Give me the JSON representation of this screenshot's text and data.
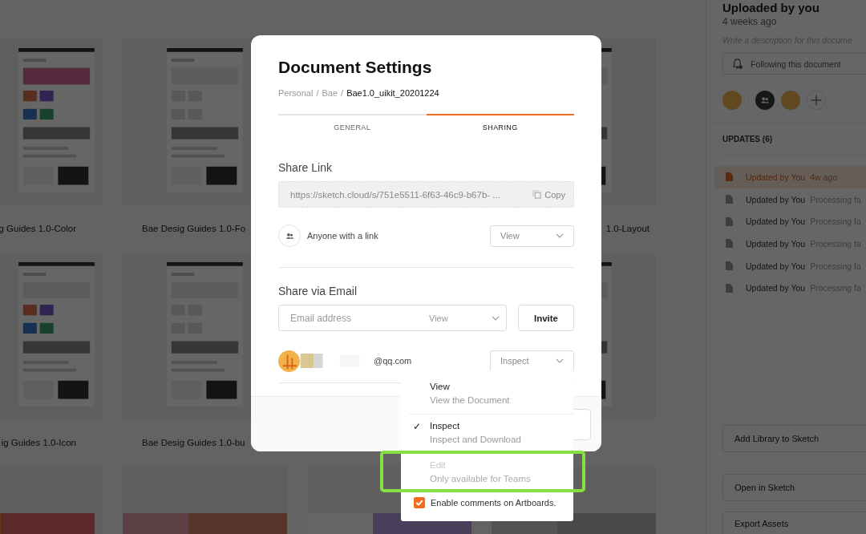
{
  "gallery": {
    "rows": [
      {
        "cards": [
          {
            "kind": "artboard",
            "label": "g Guides 1.0-Color"
          },
          {
            "kind": "artboard",
            "label": "Bae Desig Guides 1.0-Fo"
          },
          {
            "kind": "hidden"
          },
          {
            "kind": "artboard",
            "label": "1.0-Layout"
          }
        ]
      },
      {
        "cards": [
          {
            "kind": "artboard",
            "label": "ig Guides 1.0-Icon"
          },
          {
            "kind": "artboard",
            "label": "Bae Desig Guides 1.0-bu"
          },
          {
            "kind": "hidden"
          },
          {
            "kind": "artboard"
          }
        ]
      },
      {
        "cards": [
          {
            "kind": "picture"
          },
          {
            "kind": "picture"
          },
          {
            "kind": "picture"
          },
          {
            "kind": "picture"
          }
        ]
      }
    ]
  },
  "sidebar": {
    "uploader": "Uploaded by you",
    "time": "4 weeks ago",
    "description_placeholder": "Write a description for this docume",
    "follow_button": "Following this document",
    "updates_heading": "UPDATES (6)",
    "updates": [
      {
        "author": "Updated by You",
        "meta": "4w ago",
        "selected": true
      },
      {
        "author": "Updated by You",
        "meta": "Processing fa",
        "selected": false
      },
      {
        "author": "Updated by You",
        "meta": "Processing fa",
        "selected": false
      },
      {
        "author": "Updated by You",
        "meta": "Processing fa",
        "selected": false
      },
      {
        "author": "Updated by You",
        "meta": "Processing fa",
        "selected": false
      },
      {
        "author": "Updated by You",
        "meta": "Processing fa",
        "selected": false
      }
    ],
    "actions": [
      "Add Library to Sketch",
      "Open in Sketch",
      "Export Assets"
    ]
  },
  "dialog": {
    "title": "Document Settings",
    "breadcrumb": [
      "Personal",
      "Bae"
    ],
    "document": "Bae1.0_uikit_20201224",
    "separator": "/",
    "tabs": [
      {
        "label": "GENERAL",
        "selected": false
      },
      {
        "label": "SHARING",
        "selected": true
      }
    ],
    "share_link": {
      "heading": "Share Link",
      "url": "https://sketch.cloud/s/751e5511-6f63-46c9-b67b-  ...",
      "copy": "Copy",
      "audience": "Anyone with a link",
      "permission": "View"
    },
    "share_email": {
      "heading": "Share via Email",
      "placeholder": "Email address",
      "permission": "View",
      "invite": "Invite"
    },
    "members": [
      {
        "email": "@qq.com",
        "permission": "Inspect"
      }
    ]
  },
  "dropdown": {
    "options": [
      {
        "title": "View",
        "subtitle": "View the Document",
        "selected": false,
        "disabled": false
      },
      {
        "title": "Inspect",
        "subtitle": "Inspect and Download",
        "selected": true,
        "disabled": false
      },
      {
        "title": "Edit",
        "subtitle": "Only available for Teams",
        "selected": false,
        "disabled": true
      }
    ],
    "check_mark": "✓",
    "comments": {
      "label": "Enable comments on Artboards.",
      "checked": true
    }
  }
}
